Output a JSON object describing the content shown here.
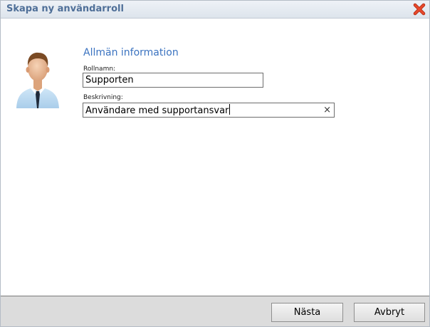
{
  "window": {
    "title": "Skapa ny användarroll",
    "close_icon": "close-icon"
  },
  "form": {
    "section_title": "Allmän information",
    "name_label": "Rollnamn:",
    "name_value": "Supporten",
    "description_label": "Beskrivning:",
    "description_value": "Användare med supportansvar",
    "clear_glyph": "×"
  },
  "footer": {
    "next_label": "Nästa",
    "cancel_label": "Avbryt"
  },
  "icons": {
    "avatar": "user-avatar-icon",
    "clear": "clear-icon"
  },
  "colors": {
    "title_text": "#4f6f98",
    "section_title": "#3b73c0",
    "close_red": "#d9371d",
    "footer_bg": "#dcdcdc"
  }
}
